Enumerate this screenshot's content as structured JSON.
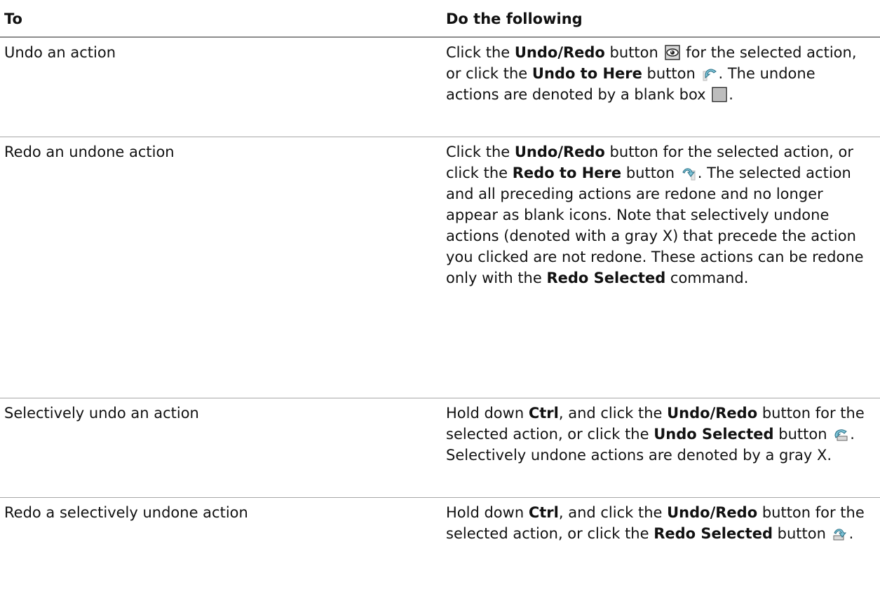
{
  "table": {
    "header": {
      "col1": "To",
      "col2": "Do the following"
    },
    "rows": [
      {
        "action": "Undo an action",
        "t1": "Click the ",
        "b1": "Undo/Redo",
        "t2": " button ",
        "t3": " for the selected action, or click the ",
        "b2": "Undo to Here",
        "t4": " button ",
        "t5": ". The undone actions are denoted by a blank box ",
        "t6": "."
      },
      {
        "action": "Redo an undone action",
        "t1": "Click the ",
        "b1": "Undo/Redo",
        "t2": " button for the selected action, or click the ",
        "b2": "Redo to Here",
        "t3": " button ",
        "t4": ". The selected action and all preceding actions are redone and no longer appear as blank icons. Note that selectively undone actions (denoted with a gray X) that precede the action you clicked are not redone. These actions can be redone only with the ",
        "b3": "Redo Selected",
        "t5": " command."
      },
      {
        "action": "Selectively undo an action",
        "t1": "Hold down ",
        "b1": "Ctrl",
        "t2": ", and click the ",
        "b2": "Undo/Redo",
        "t3": " button for the selected action, or click the ",
        "b3": "Undo Selected",
        "t4": " button ",
        "t5": ". Selectively undone actions are denoted by a gray X."
      },
      {
        "action": "Redo a selectively undone action",
        "t1": "Hold down ",
        "b1": "Ctrl",
        "t2": ", and click the ",
        "b2": "Undo/Redo",
        "t3": " button for the selected action, or click the ",
        "b3": "Redo Selected",
        "t4": " button ",
        "t5": "."
      }
    ]
  },
  "icons": [
    "undo-redo-eye-icon",
    "undo-to-here-icon",
    "blank-box-icon",
    "redo-to-here-icon",
    "undo-selected-icon",
    "redo-selected-icon"
  ]
}
